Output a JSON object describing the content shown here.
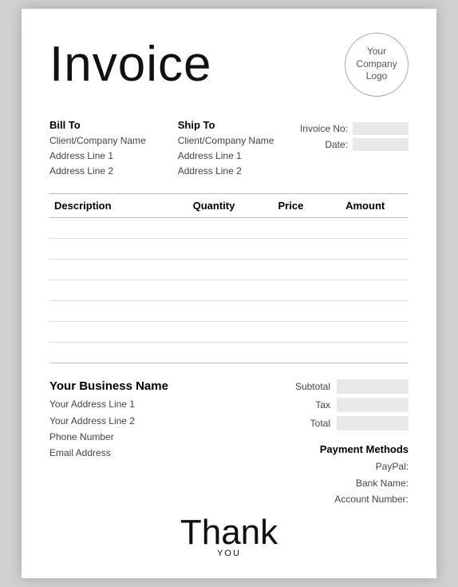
{
  "header": {
    "title": "Invoice",
    "logo_text": "Your\nCompany\nLogo"
  },
  "bill_to": {
    "label": "Bill To",
    "company": "Client/Company Name",
    "address1": "Address Line 1",
    "address2": "Address Line 2"
  },
  "ship_to": {
    "label": "Ship To",
    "company": "Client/Company Name",
    "address1": "Address Line 1",
    "address2": "Address Line 2"
  },
  "invoice_meta": {
    "invoice_no_label": "Invoice No:",
    "date_label": "Date:"
  },
  "table": {
    "headers": [
      "Description",
      "Quantity",
      "Price",
      "Amount"
    ],
    "rows": 7
  },
  "business": {
    "name": "Your Business Name",
    "address1": "Your Address Line 1",
    "address2": "Your Address Line 2",
    "phone": "Phone Number",
    "email": "Email Address"
  },
  "totals": {
    "subtotal_label": "Subtotal",
    "tax_label": "Tax",
    "total_label": "Total"
  },
  "payment": {
    "title": "Payment Methods",
    "paypal_label": "PayPal:",
    "bank_label": "Bank Name:",
    "account_label": "Account Number:"
  },
  "thankyou": {
    "text": "Thank",
    "sub": "YOU"
  }
}
